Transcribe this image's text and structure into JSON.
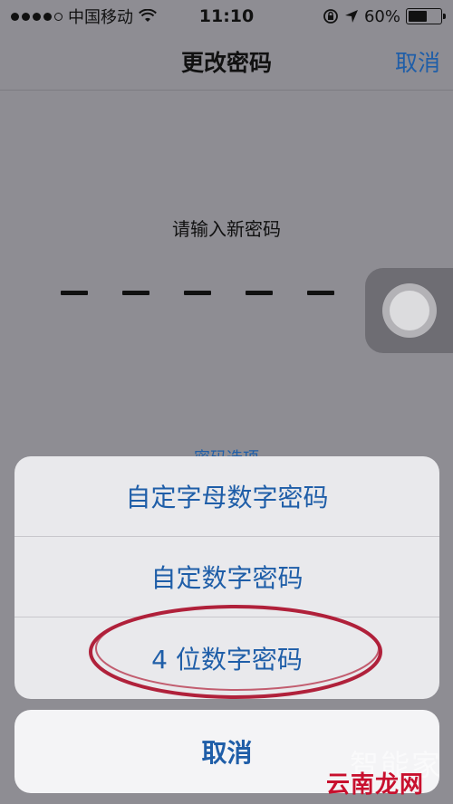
{
  "status_bar": {
    "carrier": "中国移动",
    "time": "11:10",
    "battery": "60%",
    "battery_level": 0.6,
    "icons": [
      "signal-dots-icon",
      "wifi-icon",
      "rotation-lock-icon",
      "location-arrow-icon",
      "battery-icon"
    ]
  },
  "nav": {
    "title": "更改密码",
    "cancel_label": "取消"
  },
  "passcode": {
    "prompt": "请输入新密码",
    "digit_count": 6
  },
  "options_link": "密码选项",
  "action_sheet": {
    "items": [
      {
        "label": "自定字母数字密码"
      },
      {
        "label": "自定数字密码"
      },
      {
        "label": "4 位数字密码"
      }
    ],
    "cancel_label": "取消"
  },
  "annotation": {
    "color": "#b0213b"
  },
  "watermarks": {
    "top": "智能家",
    "bottom": "云南龙网"
  },
  "colors": {
    "link_blue": "#1f5ea8",
    "dim_background": "#8e8d93",
    "sheet_background": "#e9e9ec"
  }
}
